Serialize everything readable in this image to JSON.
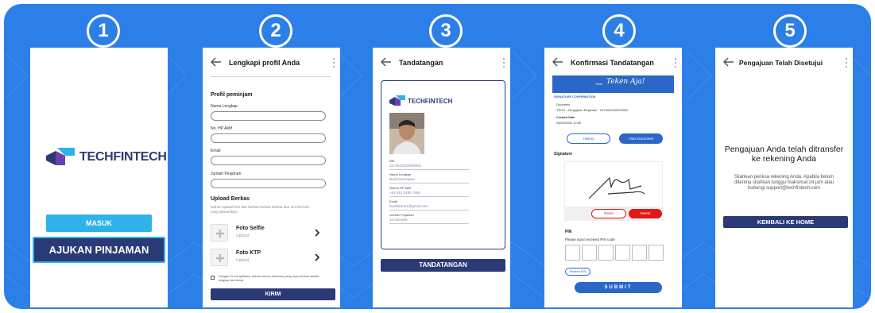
{
  "steps": [
    "1",
    "2",
    "3",
    "4",
    "5"
  ],
  "colors": {
    "background": "#2d7fe8",
    "navy": "#2b3a77",
    "light_blue": "#2fb2e8",
    "red": "#e11818"
  },
  "screen1": {
    "brand": "TECHFINTECH",
    "masuk_button": "MASUK",
    "ajukan_button": "AJUKAN PINJAMAN"
  },
  "screen2": {
    "title": "Lengkapi profil Anda",
    "section_title": "Profil peminjam",
    "fields": [
      "Nama Lengkap",
      "No. HP Aktif",
      "Email",
      "Jumlah Pinjaman"
    ],
    "upload_title": "Upload Berkas",
    "upload_desc": "Mohon upload foto dan berkas-berkas berikut dan isi informasi yang dibutuhkan.",
    "uploads": [
      {
        "title": "Foto Selfie",
        "sub": "Upload",
        "icon": "plus-icon"
      },
      {
        "title": "Foto KTP",
        "sub": "Upload",
        "icon": "plus-icon"
      }
    ],
    "agreement": "Dengan ini menyatakan, bahwa semua informasi yang saya berikan adalah lengkap dan benar",
    "submit_button": "KIRIM"
  },
  "screen3": {
    "title": "Tandatangan",
    "brand": "TECHFINTECH",
    "fields": [
      {
        "label": "NIK",
        "value": "3174042202920002"
      },
      {
        "label": "Nama Lengkap",
        "value": "Budi Darmawan"
      },
      {
        "label": "Nomor HP Aktif",
        "value": "+62 812 3456 7890"
      },
      {
        "label": "Email",
        "value": "budidarmn1@gmail.com"
      },
      {
        "label": "Jumlah Pinjaman",
        "value": "10.000.000"
      }
    ],
    "button": "TANDATANGAN"
  },
  "screen4": {
    "title": "Konfirmasi Tandatangan",
    "header_small": "Tekan",
    "header_big": "Teken Aja!",
    "section": "SIGNATURE CONFIRMATION",
    "document_label": "Document",
    "document_value": "TECH - Pengajuan Pinjaman - 3174042202920002",
    "created_label": "Created Date",
    "created_value": "28/02/2022 10:50",
    "history_button": "History",
    "view_button": "View Document",
    "signature_label": "Signature",
    "reset_button": "Reset",
    "delete_button": "Delete",
    "pin_title": "PIN",
    "pin_instruction": "Please input received PIN code",
    "resend_button": "Resend PIN",
    "submit_button": "SUBMIT"
  },
  "screen5": {
    "title": "Pengajuan Telah Disetujui",
    "headline": "Pengajuan Anda telah ditransfer ke rekening Anda",
    "body": "Silahkan periksa rekening Anda. Apabila belum diterima silahkan tunggu maksimal 24 jam atau hubungi support@techfintech.com",
    "button": "KEMBALI KE HOME"
  }
}
